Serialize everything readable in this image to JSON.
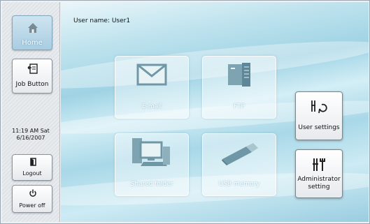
{
  "user": {
    "prefix": "User name:",
    "name": "User1"
  },
  "sidebar": {
    "home_label": "Home",
    "job_button_label": "Job Button",
    "clock_time": "11:19 AM",
    "clock_day": "Sat",
    "clock_date": "6/16/2007",
    "logout_label": "Logout",
    "power_label": "Power off"
  },
  "tiles": {
    "email": "E-mail",
    "ftp": "FTP",
    "shared": "Shared folder",
    "usb": "USB memory"
  },
  "right": {
    "user_settings": "User settings",
    "admin_line1": "Administrator",
    "admin_line2": "setting"
  },
  "colors": {
    "home_active": "#a8cde1",
    "background_accent": "#9fd3e4"
  }
}
